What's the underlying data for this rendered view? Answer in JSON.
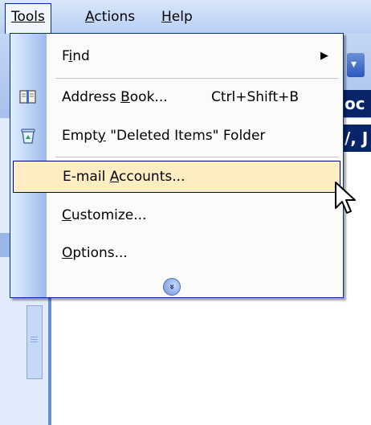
{
  "menubar": {
    "tools": "Tools",
    "actions": "Actions",
    "help": "Help"
  },
  "background": {
    "tab_top": "oc",
    "tab_bottom": "/, J"
  },
  "tools_menu": {
    "items": [
      {
        "label": "Find",
        "accel_index": 1,
        "has_submenu": true
      },
      {
        "label": "Address Book...",
        "shortcut": "Ctrl+Shift+B",
        "icon": "address-book-icon"
      },
      {
        "label": "Empty \"Deleted Items\" Folder",
        "icon": "recycle-bin-icon"
      },
      {
        "label": "E-mail Accounts...",
        "highlighted": true
      },
      {
        "label": "Customize..."
      },
      {
        "label": "Options..."
      }
    ],
    "expand_icon": "double-chevron-down-icon"
  },
  "colors": {
    "menu_border": "#002d96",
    "highlight_fill": "#ffeec2",
    "gutter": "#9dbbeb"
  }
}
